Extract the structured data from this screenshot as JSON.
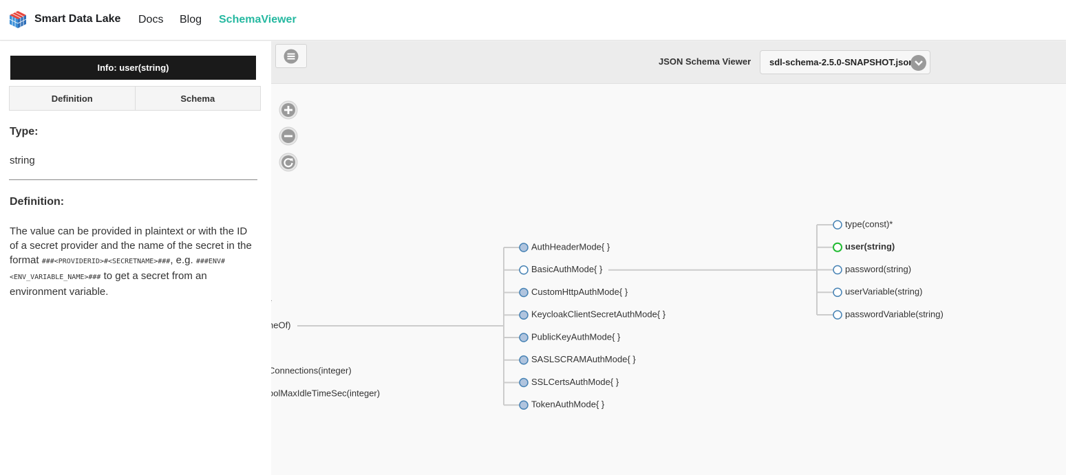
{
  "navbar": {
    "brand_title": "Smart Data Lake",
    "links": [
      {
        "label": "Docs"
      },
      {
        "label": "Blog"
      },
      {
        "label": "SchemaViewer",
        "active": true
      }
    ],
    "active_color": "#25b8a0"
  },
  "sidebar": {
    "info_header": "Info: user(string)",
    "tabs": [
      "Definition",
      "Schema"
    ],
    "type_label": "Type:",
    "type_value": "string",
    "definition_label": "Definition:",
    "definition": {
      "p1": "The value can be provided in plaintext or with the ID of a secret provider and the name of the secret in the format ",
      "code1": "###<PROVIDERID>#<SECRETNAME>###",
      "p2": ", e.g. ",
      "code2": "###ENV#<ENV_VARIABLE_NAME>###",
      "p3": " to get a secret from an environment variable."
    }
  },
  "toolbar": {
    "menu_icon": "hamburger-icon",
    "viewer_label": "JSON Schema Viewer",
    "schema_file": "sdl-schema-2.5.0-SNAPSHOT.json"
  },
  "zoom_controls": [
    {
      "name": "zoom-in-icon"
    },
    {
      "name": "zoom-out-icon"
    },
    {
      "name": "reset-zoom-icon"
    }
  ],
  "tree": {
    "left_partial": [
      "*",
      "neOf)",
      "Connections(integer)",
      "oolMaxIdleTimeSec(integer)"
    ],
    "auth_modes": [
      "AuthHeaderMode{ }",
      "BasicAuthMode{ }",
      "CustomHttpAuthMode{ }",
      "KeycloakClientSecretAuthMode{ }",
      "PublicKeyAuthMode{ }",
      "SASLSCRAMAuthMode{ }",
      "SSLCertsAuthMode{ }",
      "TokenAuthMode{ }"
    ],
    "basic_auth_props": [
      {
        "label": "type(const)*",
        "state": "normal"
      },
      {
        "label": "user(string)",
        "state": "selected"
      },
      {
        "label": "password(string)",
        "state": "normal"
      },
      {
        "label": "userVariable(string)",
        "state": "optional"
      },
      {
        "label": "passwordVariable(string)",
        "state": "optional"
      }
    ],
    "colors": {
      "link": "#cccccc",
      "collapsed_fill": "#b0c4de",
      "node_stroke": "#4682b4",
      "selected": "#22bb33",
      "optional_text": "#f0a030"
    }
  }
}
